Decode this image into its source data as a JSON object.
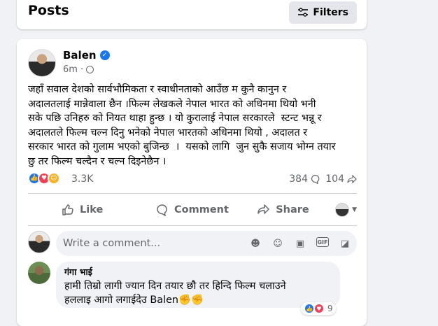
{
  "header": {
    "title": "Posts",
    "filters_label": "Filters"
  },
  "post": {
    "author": "Balen",
    "time": "6m",
    "text": "जहाँ सवाल देशको सार्वभौमिकता र स्वाधीनताको आउँछ म कुनै कानुन र\nअदालतलाई मान्नेवाला छैन ।फिल्म लेखकले नेपाल भारत को अधिनमा थियो भनी\nसके पछि उनिहरु को नियत थाहा हुन्छ । यो कुरालाई नेपाल सरकारले  स्टन्ट भन्नू र\nअदालतले फिल्म चल्न दिनु भनेको नेपाल भारतको अधिनमा थियो , अदालत र\nसरकार भारत को गुलाम भएको बुजिन्छ  ।  यसको लागि  जुन सुकै सजाय भोग्न तयार\nछु तर फिल्म चल्दैन र चल्न दिइनेछैन ।",
    "reaction_count": "3.3K",
    "comment_count": "384",
    "share_count": "104"
  },
  "actions": {
    "like": "Like",
    "comment": "Comment",
    "share": "Share"
  },
  "composer": {
    "placeholder": "Write a comment..."
  },
  "comment": {
    "name": "गंगा भाई",
    "text": "हामी तिम्रो लागी ज्यान दिन तयार छौ तर हिन्दि फिल्म चलाउने\nहललाइ आगो लगाईदेउ Balen✊✊",
    "reaction_count": "9"
  },
  "colors": {
    "accent": "#1877f2",
    "love": "#f33e58",
    "care": "#f7b125"
  }
}
